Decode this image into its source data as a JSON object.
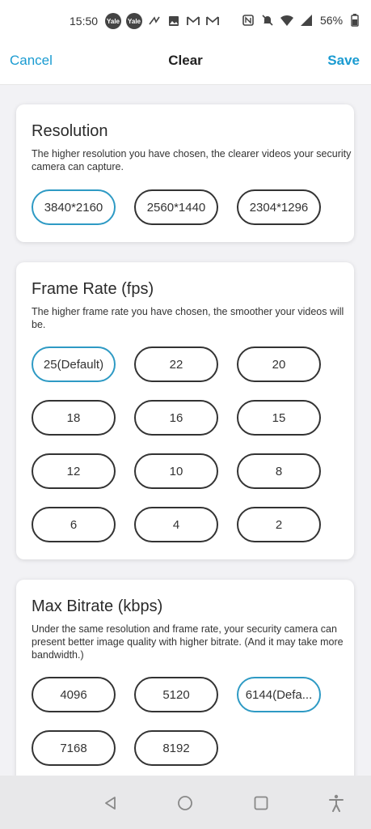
{
  "status_bar": {
    "time": "15:50",
    "yale_badge": "Yale",
    "battery": "56%"
  },
  "header": {
    "cancel": "Cancel",
    "title": "Clear",
    "save": "Save"
  },
  "resolution": {
    "title": "Resolution",
    "description": "The higher resolution you have chosen, the clearer videos your security camera can capture.",
    "options": [
      "3840*2160",
      "2560*1440",
      "2304*1296"
    ],
    "selected": "3840*2160"
  },
  "frame_rate": {
    "title": "Frame Rate (fps)",
    "description": "The higher frame rate you have chosen, the smoother your videos will be.",
    "options": [
      "25(Default)",
      "22",
      "20",
      "18",
      "16",
      "15",
      "12",
      "10",
      "8",
      "6",
      "4",
      "2"
    ],
    "selected": "25(Default)"
  },
  "max_bitrate": {
    "title": "Max Bitrate (kbps)",
    "description": "Under the same resolution and frame rate, your security camera can present better image quality with higher bitrate. (And it may take more bandwidth.)",
    "options": [
      "4096",
      "5120",
      "6144(Defa...",
      "7168",
      "8192"
    ],
    "selected": "6144(Defa..."
  },
  "colors": {
    "accent": "#1a9bd1",
    "selected_border": "#2e9ac4"
  }
}
